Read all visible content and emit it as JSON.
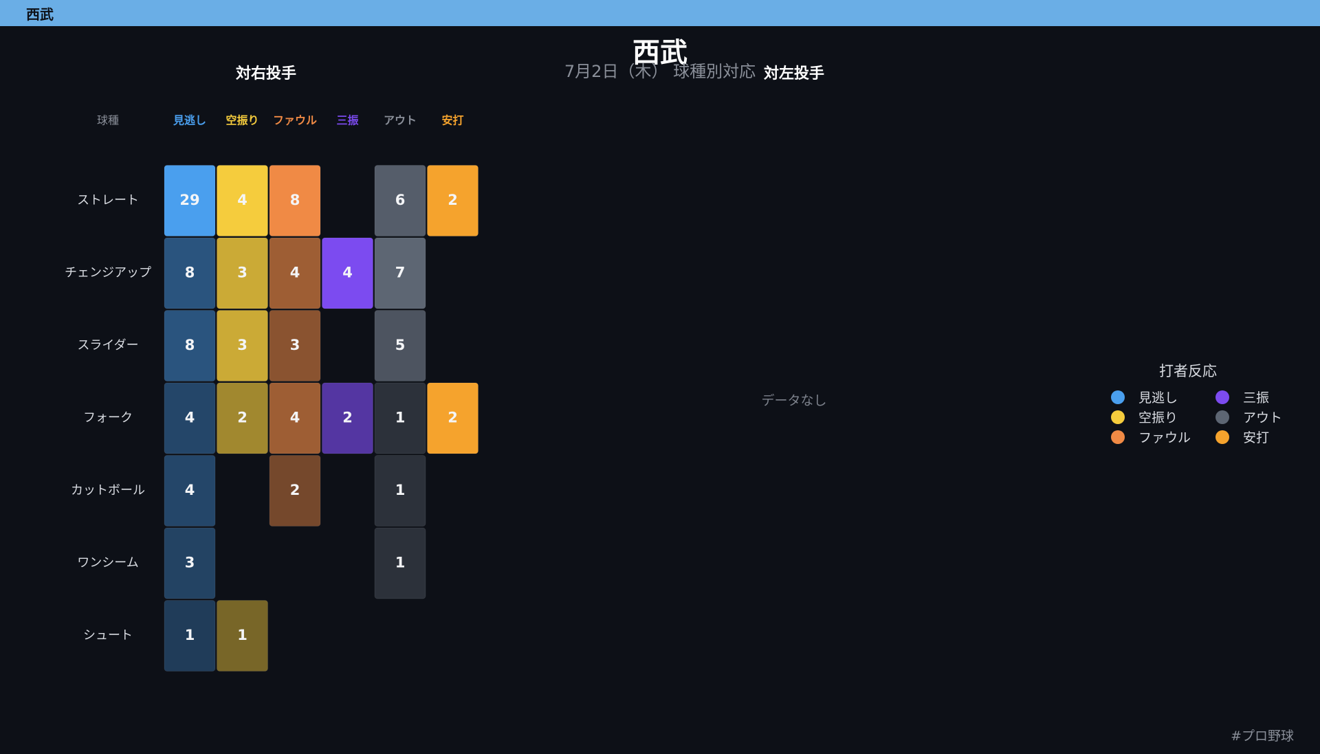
{
  "topbar": {
    "title": "西武"
  },
  "header": {
    "title": "西武",
    "subtitle": "7月2日（木） 球種別対応"
  },
  "panels": {
    "right_title": "対右投手",
    "left_title": "対左投手",
    "left_empty_text": "データなし"
  },
  "footer": {
    "hashtag": "#プロ野球"
  },
  "legend": {
    "title": "打者反応",
    "items": [
      {
        "label": "見逃し",
        "color": "#4a9fee"
      },
      {
        "label": "空振り",
        "color": "#f5cc3d"
      },
      {
        "label": "ファウル",
        "color": "#f08a45"
      },
      {
        "label": "三振",
        "color": "#7c4bf0"
      },
      {
        "label": "アウト",
        "color": "#5d6673"
      },
      {
        "label": "安打",
        "color": "#f5a32d"
      }
    ]
  },
  "chart_data": {
    "type": "heatmap",
    "title": "対右投手",
    "row_header": "球種",
    "columns": [
      "見逃し",
      "空振り",
      "ファウル",
      "三振",
      "アウト",
      "安打"
    ],
    "column_colors": [
      "#4a9fee",
      "#f5cc3d",
      "#f08a45",
      "#7c4bf0",
      "#5d6673",
      "#f5a32d"
    ],
    "rows": [
      "ストレート",
      "チェンジアップ",
      "スライダー",
      "フォーク",
      "カットボール",
      "ワンシーム",
      "シュート"
    ],
    "values": [
      [
        29,
        4,
        8,
        null,
        6,
        2
      ],
      [
        8,
        3,
        4,
        4,
        7,
        null
      ],
      [
        8,
        3,
        3,
        null,
        5,
        null
      ],
      [
        4,
        2,
        4,
        2,
        1,
        2
      ],
      [
        4,
        null,
        2,
        null,
        1,
        null
      ],
      [
        3,
        null,
        null,
        null,
        1,
        null
      ],
      [
        1,
        1,
        null,
        null,
        null,
        null
      ]
    ]
  }
}
